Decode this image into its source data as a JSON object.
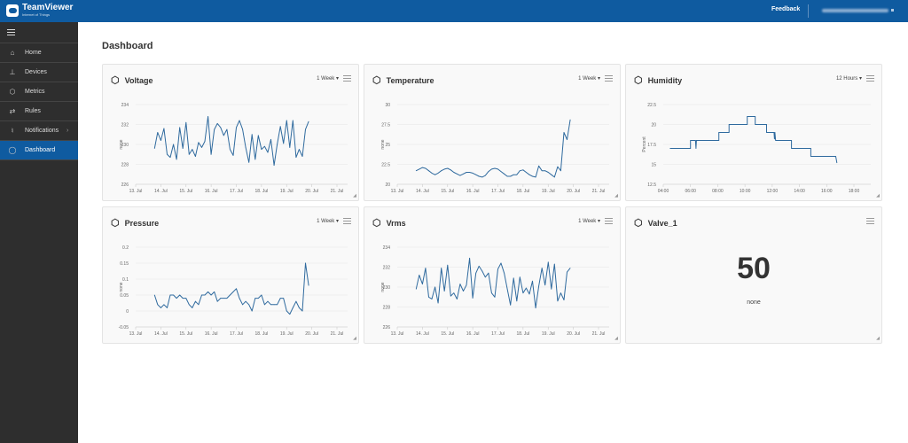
{
  "header": {
    "brand": "TeamViewer",
    "brand_sub": "Internet of Things",
    "feedback": "Feedback"
  },
  "sidebar": {
    "items": [
      {
        "label": "Home",
        "icon": "home-icon"
      },
      {
        "label": "Devices",
        "icon": "devices-icon"
      },
      {
        "label": "Metrics",
        "icon": "cube-icon"
      },
      {
        "label": "Rules",
        "icon": "rules-icon"
      },
      {
        "label": "Notifications",
        "icon": "bell-icon"
      },
      {
        "label": "Dashboard",
        "icon": "dashboard-icon",
        "active": true
      }
    ]
  },
  "page": {
    "title": "Dashboard"
  },
  "colors": {
    "header": "#0f5ba0",
    "sidebar": "#2e2e2e",
    "line": "#2f6a9e"
  },
  "valve": {
    "title": "Valve_1",
    "value": "50",
    "unit": "none"
  },
  "chart_data": [
    {
      "type": "line",
      "title": "Voltage",
      "range": "1 Week",
      "ylabel": "none",
      "ylim": [
        226,
        234
      ],
      "yticks": [
        "226",
        "228",
        "230",
        "232",
        "234"
      ],
      "xticks": [
        "13. Jul",
        "14. Jul",
        "15. Jul",
        "16. Jul",
        "17. Jul",
        "18. Jul",
        "19. Jul",
        "20. Jul",
        "21. Jul"
      ],
      "x": [
        "13 Jul 18:00",
        "13 Jul 21:00",
        "14 Jul 00:00",
        "14 Jul 03:00",
        "14 Jul 06:00",
        "14 Jul 09:00",
        "14 Jul 12:00",
        "14 Jul 15:00",
        "14 Jul 18:00",
        "14 Jul 21:00",
        "15 Jul 00:00",
        "15 Jul 03:00",
        "15 Jul 06:00",
        "15 Jul 09:00",
        "15 Jul 12:00",
        "15 Jul 15:00",
        "15 Jul 18:00",
        "15 Jul 21:00",
        "16 Jul 00:00",
        "16 Jul 03:00",
        "16 Jul 06:00",
        "16 Jul 09:00",
        "16 Jul 12:00",
        "16 Jul 15:00",
        "16 Jul 18:00",
        "16 Jul 21:00",
        "17 Jul 00:00",
        "17 Jul 03:00",
        "17 Jul 06:00",
        "17 Jul 09:00",
        "17 Jul 12:00",
        "17 Jul 15:00",
        "17 Jul 18:00",
        "17 Jul 21:00",
        "18 Jul 00:00",
        "18 Jul 03:00",
        "18 Jul 06:00",
        "18 Jul 09:00",
        "18 Jul 12:00",
        "18 Jul 15:00",
        "18 Jul 18:00",
        "18 Jul 21:00",
        "19 Jul 00:00",
        "19 Jul 03:00",
        "19 Jul 06:00",
        "19 Jul 09:00",
        "19 Jul 12:00",
        "19 Jul 15:00",
        "19 Jul 18:00",
        "19 Jul 21:00"
      ],
      "y": [
        229.6,
        231.2,
        230.4,
        231.6,
        229.0,
        228.7,
        230.0,
        228.5,
        231.7,
        229.6,
        232.2,
        229.0,
        229.5,
        228.8,
        230.2,
        229.7,
        230.3,
        232.8,
        229.0,
        231.5,
        232.1,
        231.7,
        230.9,
        231.5,
        229.5,
        228.9,
        231.7,
        232.4,
        231.5,
        229.7,
        228.2,
        231.0,
        228.5,
        230.9,
        229.5,
        229.8,
        229.2,
        230.5,
        227.9,
        230.0,
        231.8,
        230.1,
        232.4,
        229.7,
        232.4,
        228.7,
        229.5,
        228.8,
        231.5,
        232.3
      ]
    },
    {
      "type": "line",
      "title": "Temperature",
      "range": "1 Week",
      "ylabel": "none",
      "ylim": [
        20,
        30
      ],
      "yticks": [
        "20",
        "22.5",
        "25",
        "27.5",
        "30"
      ],
      "xticks": [
        "13. Jul",
        "14. Jul",
        "15. Jul",
        "16. Jul",
        "17. Jul",
        "18. Jul",
        "19. Jul",
        "20. Jul",
        "21. Jul"
      ],
      "x": [
        "13 Jul 18:00",
        "13 Jul 21:00",
        "14 Jul 00:00",
        "14 Jul 03:00",
        "14 Jul 06:00",
        "14 Jul 09:00",
        "14 Jul 12:00",
        "14 Jul 15:00",
        "14 Jul 18:00",
        "14 Jul 21:00",
        "15 Jul 00:00",
        "15 Jul 03:00",
        "15 Jul 06:00",
        "15 Jul 09:00",
        "15 Jul 12:00",
        "15 Jul 15:00",
        "15 Jul 18:00",
        "15 Jul 21:00",
        "16 Jul 00:00",
        "16 Jul 03:00",
        "16 Jul 06:00",
        "16 Jul 09:00",
        "16 Jul 12:00",
        "16 Jul 15:00",
        "16 Jul 18:00",
        "16 Jul 21:00",
        "17 Jul 00:00",
        "17 Jul 03:00",
        "17 Jul 06:00",
        "17 Jul 09:00",
        "17 Jul 12:00",
        "17 Jul 15:00",
        "17 Jul 18:00",
        "17 Jul 21:00",
        "18 Jul 00:00",
        "18 Jul 03:00",
        "18 Jul 06:00",
        "18 Jul 09:00",
        "18 Jul 12:00",
        "18 Jul 15:00",
        "18 Jul 18:00",
        "18 Jul 21:00",
        "19 Jul 00:00",
        "19 Jul 03:00",
        "19 Jul 06:00",
        "19 Jul 09:00",
        "19 Jul 12:00",
        "19 Jul 15:00",
        "19 Jul 18:00",
        "19 Jul 21:00"
      ],
      "y": [
        21.7,
        21.9,
        22.1,
        22.0,
        21.7,
        21.4,
        21.2,
        21.4,
        21.7,
        21.9,
        22.0,
        21.8,
        21.5,
        21.3,
        21.1,
        21.3,
        21.5,
        21.5,
        21.4,
        21.2,
        21.0,
        20.9,
        21.1,
        21.6,
        21.9,
        22.0,
        21.9,
        21.6,
        21.3,
        21.0,
        21.0,
        21.2,
        21.2,
        21.7,
        21.8,
        21.5,
        21.2,
        21.0,
        20.9,
        22.3,
        21.7,
        21.7,
        21.5,
        21.2,
        20.9,
        22.2,
        21.7,
        26.5,
        25.6,
        28.1
      ]
    },
    {
      "type": "line",
      "title": "Humidity",
      "range": "12 Hours",
      "ylabel": "Percent",
      "ylim": [
        12.5,
        22.5
      ],
      "yticks": [
        "12.5",
        "15",
        "17.5",
        "20",
        "22.5"
      ],
      "xticks": [
        "04:00",
        "06:00",
        "08:00",
        "10:00",
        "12:00",
        "14:00",
        "16:00",
        "18:00"
      ],
      "x": [
        "04:30",
        "06:00",
        "06:00",
        "06:22",
        "06:24",
        "06:26",
        "08:05",
        "08:05",
        "08:50",
        "08:50",
        "10:10",
        "10:10",
        "10:45",
        "10:45",
        "11:35",
        "11:35",
        "12:08",
        "12:10",
        "12:12",
        "12:15",
        "13:25",
        "13:25",
        "14:50",
        "14:50",
        "16:40",
        "16:45"
      ],
      "y": [
        17,
        17,
        18,
        18,
        17,
        18,
        18,
        19,
        19,
        20,
        20,
        21,
        21,
        20,
        20,
        19,
        19,
        18.2,
        19,
        18,
        18,
        17,
        17,
        16,
        16,
        15.2
      ]
    },
    {
      "type": "line",
      "title": "Pressure",
      "range": "1 Week",
      "ylabel": "none",
      "ylim": [
        -0.05,
        0.2
      ],
      "yticks": [
        "-0.05",
        "0",
        "0.05",
        "0.1",
        "0.15",
        "0.2"
      ],
      "xticks": [
        "13. Jul",
        "14. Jul",
        "15. Jul",
        "16. Jul",
        "17. Jul",
        "18. Jul",
        "19. Jul",
        "20. Jul",
        "21. Jul"
      ],
      "x": [
        "13 Jul 18:00",
        "13 Jul 21:00",
        "14 Jul 00:00",
        "14 Jul 03:00",
        "14 Jul 06:00",
        "14 Jul 09:00",
        "14 Jul 12:00",
        "14 Jul 15:00",
        "14 Jul 18:00",
        "14 Jul 21:00",
        "15 Jul 00:00",
        "15 Jul 03:00",
        "15 Jul 06:00",
        "15 Jul 09:00",
        "15 Jul 12:00",
        "15 Jul 15:00",
        "15 Jul 18:00",
        "15 Jul 21:00",
        "16 Jul 00:00",
        "16 Jul 03:00",
        "16 Jul 06:00",
        "16 Jul 09:00",
        "16 Jul 12:00",
        "16 Jul 15:00",
        "16 Jul 18:00",
        "16 Jul 21:00",
        "17 Jul 00:00",
        "17 Jul 03:00",
        "17 Jul 06:00",
        "17 Jul 09:00",
        "17 Jul 12:00",
        "17 Jul 15:00",
        "17 Jul 18:00",
        "17 Jul 21:00",
        "18 Jul 00:00",
        "18 Jul 03:00",
        "18 Jul 06:00",
        "18 Jul 09:00",
        "18 Jul 12:00",
        "18 Jul 15:00",
        "18 Jul 18:00",
        "18 Jul 21:00",
        "19 Jul 00:00",
        "19 Jul 03:00",
        "19 Jul 06:00",
        "19 Jul 09:00",
        "19 Jul 12:00",
        "19 Jul 15:00",
        "19 Jul 18:00",
        "19 Jul 21:00"
      ],
      "y": [
        0.05,
        0.02,
        0.01,
        0.02,
        0.01,
        0.05,
        0.05,
        0.04,
        0.05,
        0.04,
        0.04,
        0.02,
        0.01,
        0.03,
        0.02,
        0.05,
        0.05,
        0.06,
        0.05,
        0.06,
        0.03,
        0.04,
        0.04,
        0.04,
        0.05,
        0.06,
        0.07,
        0.04,
        0.02,
        0.03,
        0.02,
        0.0,
        0.04,
        0.04,
        0.05,
        0.02,
        0.03,
        0.02,
        0.02,
        0.02,
        0.04,
        0.04,
        0.0,
        -0.01,
        0.01,
        0.03,
        0.01,
        0.0,
        0.15,
        0.08
      ]
    },
    {
      "type": "line",
      "title": "Vrms",
      "range": "1 Week",
      "ylabel": "none",
      "ylim": [
        226,
        234
      ],
      "yticks": [
        "226",
        "228",
        "230",
        "232",
        "234"
      ],
      "xticks": [
        "13. Jul",
        "14. Jul",
        "15. Jul",
        "16. Jul",
        "17. Jul",
        "18. Jul",
        "19. Jul",
        "20. Jul",
        "21. Jul"
      ],
      "x": [
        "13 Jul 18:00",
        "13 Jul 21:00",
        "14 Jul 00:00",
        "14 Jul 03:00",
        "14 Jul 06:00",
        "14 Jul 09:00",
        "14 Jul 12:00",
        "14 Jul 15:00",
        "14 Jul 18:00",
        "14 Jul 21:00",
        "15 Jul 00:00",
        "15 Jul 03:00",
        "15 Jul 06:00",
        "15 Jul 09:00",
        "15 Jul 12:00",
        "15 Jul 15:00",
        "15 Jul 18:00",
        "15 Jul 21:00",
        "16 Jul 00:00",
        "16 Jul 03:00",
        "16 Jul 06:00",
        "16 Jul 09:00",
        "16 Jul 12:00",
        "16 Jul 15:00",
        "16 Jul 18:00",
        "16 Jul 21:00",
        "17 Jul 00:00",
        "17 Jul 03:00",
        "17 Jul 06:00",
        "17 Jul 09:00",
        "17 Jul 12:00",
        "17 Jul 15:00",
        "17 Jul 18:00",
        "17 Jul 21:00",
        "18 Jul 00:00",
        "18 Jul 03:00",
        "18 Jul 06:00",
        "18 Jul 09:00",
        "18 Jul 12:00",
        "18 Jul 15:00",
        "18 Jul 18:00",
        "18 Jul 21:00",
        "19 Jul 00:00",
        "19 Jul 03:00",
        "19 Jul 06:00",
        "19 Jul 09:00",
        "19 Jul 12:00",
        "19 Jul 15:00",
        "19 Jul 18:00",
        "19 Jul 21:00"
      ],
      "y": [
        229.8,
        231.2,
        230.3,
        231.9,
        229.0,
        228.8,
        230.0,
        228.4,
        231.9,
        229.6,
        232.2,
        229.1,
        229.4,
        228.8,
        230.3,
        229.6,
        230.2,
        232.9,
        228.9,
        231.4,
        232.1,
        231.6,
        231.0,
        231.4,
        229.4,
        229.0,
        231.8,
        232.4,
        231.4,
        229.8,
        228.2,
        230.9,
        228.6,
        231.0,
        229.4,
        229.9,
        229.3,
        230.6,
        227.9,
        230.1,
        231.9,
        230.2,
        232.5,
        229.8,
        232.3,
        228.6,
        229.4,
        228.7,
        231.5,
        231.9
      ]
    }
  ]
}
